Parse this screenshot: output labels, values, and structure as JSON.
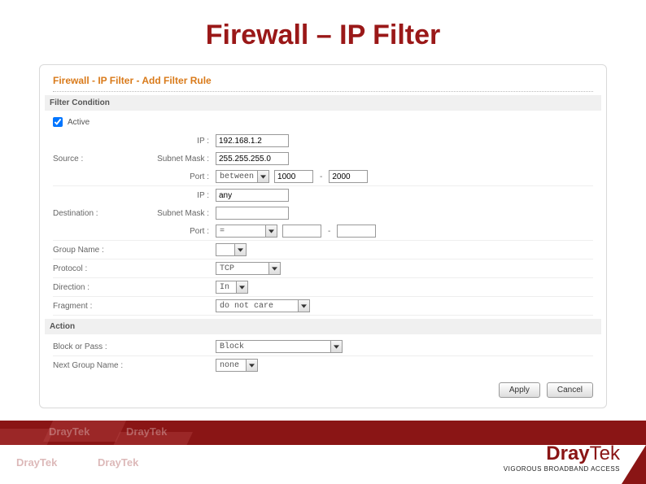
{
  "title": "Firewall – IP Filter",
  "panel": {
    "heading": "Firewall - IP Filter - Add Filter Rule",
    "filter_condition": "Filter Condition",
    "active_label": "Active",
    "source_label": "Source :",
    "dest_label": "Destination :",
    "ip_label": "IP :",
    "subnet_label": "Subnet Mask :",
    "port_label": "Port :",
    "group_label": "Group Name :",
    "protocol_label": "Protocol :",
    "direction_label": "Direction :",
    "fragment_label": "Fragment :",
    "action": "Action",
    "block_label": "Block or Pass :",
    "next_group_label": "Next Group Name :",
    "apply": "Apply",
    "cancel": "Cancel"
  },
  "values": {
    "src_ip": "192.168.1.2",
    "src_mask": "255.255.255.0",
    "src_port_mode": "between",
    "src_port_a": "1000",
    "src_port_b": "2000",
    "dst_ip": "any",
    "dst_mask": "",
    "dst_port_mode": "=",
    "dst_port_a": "",
    "dst_port_b": "",
    "group": "",
    "protocol": "TCP",
    "direction": "In",
    "fragment": "do not care",
    "block": "Block",
    "next_group": "none"
  },
  "brand": {
    "name_a": "Dray",
    "name_b": "Tek",
    "tag": "VIGOROUS BROADBAND ACCESS",
    "ghost1": "DrayTek",
    "ghost2": "DrayTek",
    "ghost3": "DrayTek",
    "ghost4": "DrayTek"
  }
}
